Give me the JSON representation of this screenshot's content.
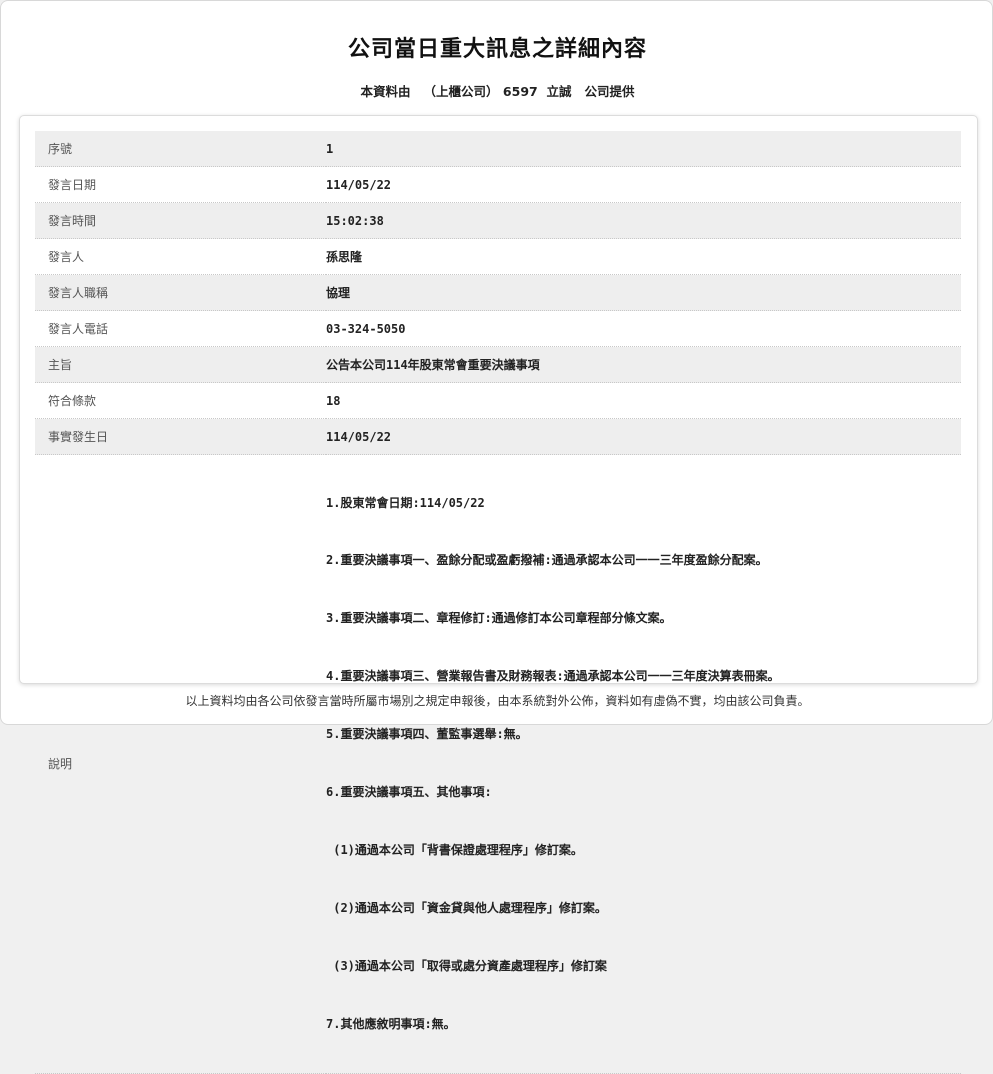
{
  "title": "公司當日重大訊息之詳細內容",
  "provider": {
    "prefix": "本資料由",
    "market": "（上櫃公司）",
    "code": "6597",
    "company": "立誠",
    "suffix": "公司提供"
  },
  "rows": [
    {
      "label": "序號",
      "value": "1"
    },
    {
      "label": "發言日期",
      "value": "114/05/22"
    },
    {
      "label": "發言時間",
      "value": "15:02:38"
    },
    {
      "label": "發言人",
      "value": "孫思隆"
    },
    {
      "label": "發言人職稱",
      "value": "協理"
    },
    {
      "label": "發言人電話",
      "value": "03-324-5050"
    },
    {
      "label": "主旨",
      "value": "公告本公司114年股東常會重要決議事項"
    },
    {
      "label": "符合條款",
      "value": "18"
    },
    {
      "label": "事實發生日",
      "value": "114/05/22"
    }
  ],
  "description": {
    "label": "說明",
    "lines": [
      "1.股東常會日期:114/05/22",
      "2.重要決議事項一、盈餘分配或盈虧撥補:通過承認本公司一一三年度盈餘分配案。",
      "3.重要決議事項二、章程修訂:通過修訂本公司章程部分條文案。",
      "4.重要決議事項三、營業報告書及財務報表:通過承認本公司一一三年度決算表冊案。",
      "5.重要決議事項四、董監事選舉:無。",
      "6.重要決議事項五、其他事項:",
      " (1)通過本公司「背書保證處理程序」修訂案。",
      " (2)通過本公司「資金貸與他人處理程序」修訂案。",
      " (3)通過本公司「取得或處分資產處理程序」修訂案",
      "7.其他應敘明事項:無。"
    ]
  },
  "footer": "以上資料均由各公司依發言當時所屬市場別之規定申報後，由本系統對外公佈，資料如有虛偽不實，均由該公司負責。"
}
